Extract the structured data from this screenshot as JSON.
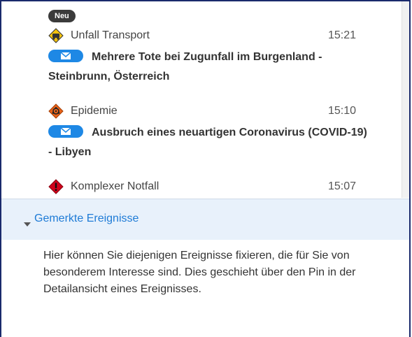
{
  "badge": {
    "label": "Neu"
  },
  "events": [
    {
      "category": "Unfall Transport",
      "time": "15:21",
      "title": "Mehrere Tote bei Zugunfall im Burgenland - Steinbrunn, Österreich",
      "icon": "accident-transport-icon"
    },
    {
      "category": "Epidemie",
      "time": "15:10",
      "title": "Ausbruch eines neuartigen Coronavirus (COVID-19) - Libyen",
      "icon": "biohazard-icon"
    },
    {
      "category": "Komplexer Notfall",
      "time": "15:07",
      "icon": "warning-diamond-icon"
    }
  ],
  "section": {
    "title": "Gemerkte Ereignisse",
    "info": "Hier können Sie diejenigen Ereignisse fixieren, die für Sie von besonderem Interesse sind. Dies geschieht über den Pin in der Detailansicht eines Ereignisses."
  },
  "colors": {
    "accent": "#1e88e5",
    "section_bg": "#e8f1fb",
    "section_title": "#1e7bd6",
    "badge_bg": "#3b3b3b",
    "frame": "#1a2a6c"
  }
}
